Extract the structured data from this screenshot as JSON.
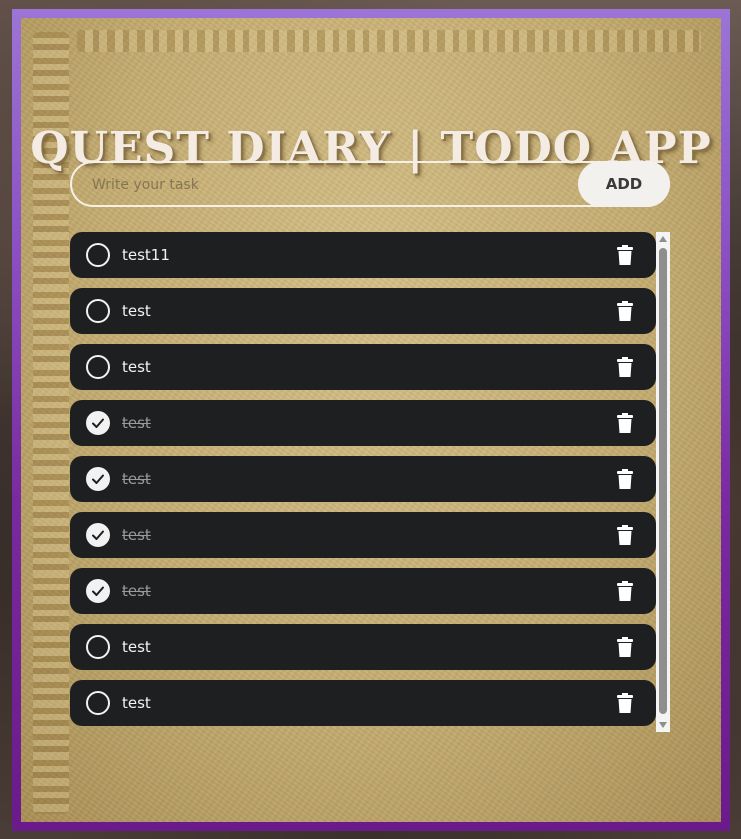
{
  "app": {
    "title": "QUEST DIARY | TODO APP"
  },
  "input": {
    "placeholder": "Write your task",
    "value": "",
    "add_label": "ADD"
  },
  "tasks": [
    {
      "text": "test11",
      "done": false
    },
    {
      "text": "test",
      "done": false
    },
    {
      "text": "test",
      "done": false
    },
    {
      "text": "test",
      "done": true
    },
    {
      "text": "test",
      "done": true
    },
    {
      "text": "test",
      "done": true
    },
    {
      "text": "test",
      "done": true
    },
    {
      "text": "test",
      "done": false
    },
    {
      "text": "test",
      "done": false
    }
  ],
  "icons": {
    "check": "check-circle-icon",
    "delete": "trash-icon"
  },
  "colors": {
    "frame_gradient_start": "#9c74d6",
    "frame_gradient_end": "#6a1a8a",
    "parchment": "#c9b27a",
    "task_bg": "#1d1f21",
    "task_text": "#f2f2f2",
    "task_done_text": "#9a9a9a",
    "add_button_bg": "#f3f1ee"
  }
}
